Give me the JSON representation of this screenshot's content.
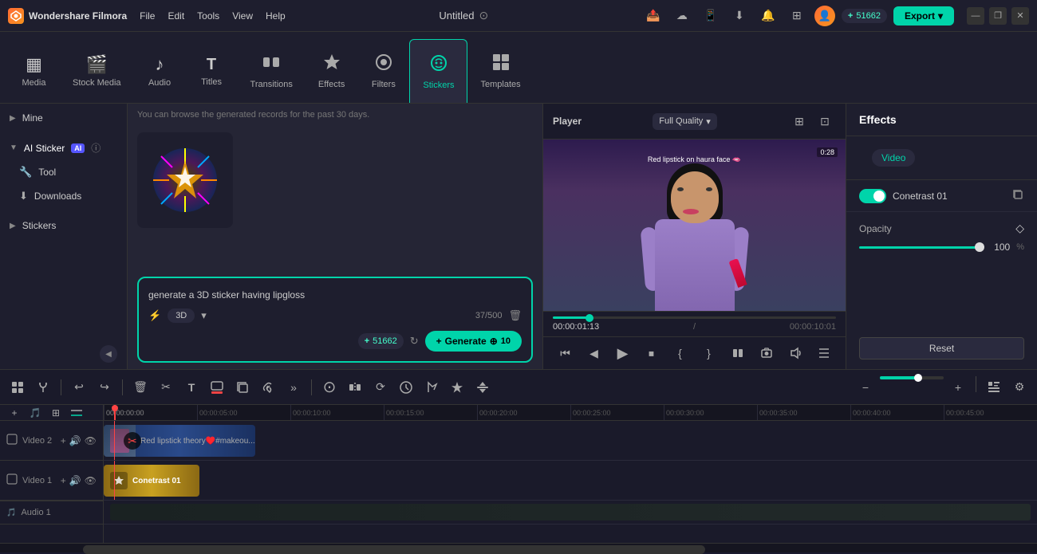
{
  "app": {
    "name": "Wondershare Filmora",
    "logo_text": "W",
    "project_title": "Untitled"
  },
  "menu": {
    "items": [
      "File",
      "Edit",
      "Tools",
      "View",
      "Help"
    ]
  },
  "toolbar": {
    "tabs": [
      {
        "id": "media",
        "label": "Media",
        "icon": "▦"
      },
      {
        "id": "stock",
        "label": "Stock Media",
        "icon": "🎬"
      },
      {
        "id": "audio",
        "label": "Audio",
        "icon": "♪"
      },
      {
        "id": "titles",
        "label": "Titles",
        "icon": "T"
      },
      {
        "id": "transitions",
        "label": "Transitions",
        "icon": "⊡"
      },
      {
        "id": "effects",
        "label": "Effects",
        "icon": "✦"
      },
      {
        "id": "filters",
        "label": "Filters",
        "icon": "◉"
      },
      {
        "id": "stickers",
        "label": "Stickers",
        "icon": "⊛",
        "active": true
      },
      {
        "id": "templates",
        "label": "Templates",
        "icon": "⊞"
      }
    ]
  },
  "sidebar": {
    "items": [
      {
        "label": "Mine",
        "type": "collapsible",
        "expanded": false
      },
      {
        "label": "AI Sticker",
        "type": "collapsible",
        "expanded": true,
        "has_ai": true,
        "has_info": true
      },
      {
        "label": "Tool",
        "type": "sub",
        "icon": "🔧"
      },
      {
        "label": "Downloads",
        "type": "sub",
        "icon": "⬇"
      },
      {
        "label": "Stickers",
        "type": "collapsible",
        "expanded": false
      }
    ]
  },
  "content": {
    "info_text": "You can browse the generated records for the past 30 days.",
    "generate_prompt": "generate a 3D sticker having lipgloss",
    "char_count": "37/500",
    "style_tag": "3D",
    "credits_value": "51662",
    "generate_btn_label": "Generate",
    "generate_credits": "10",
    "refresh_tooltip": "Refresh"
  },
  "player": {
    "label": "Player",
    "quality": "Full Quality",
    "time_current": "00:00:01:13",
    "time_total": "00:00:10:01",
    "progress_percent": 13,
    "video_text": "0:28",
    "video_overlay": "Red lipstick on haura face 🫦",
    "controls": [
      "skip-back",
      "prev-frame",
      "play",
      "stop",
      "mark-in",
      "mark-out",
      "ripple-edit",
      "snapshot",
      "volume",
      "more"
    ]
  },
  "effects_panel": {
    "title": "Effects",
    "video_tab": "Video",
    "effect_name": "Conetrast 01",
    "effect_enabled": true,
    "opacity_label": "Opacity",
    "opacity_value": "100",
    "opacity_percent": "%",
    "reset_label": "Reset"
  },
  "timeline": {
    "tracks": [
      {
        "id": "video2",
        "label": "Video 2",
        "number": "2"
      },
      {
        "id": "video1",
        "label": "Video 1",
        "number": "1"
      },
      {
        "id": "audio1",
        "label": "Audio 1",
        "number": "1"
      }
    ],
    "clips": {
      "video2_label": "Red lipstick theory♥️#makeou...",
      "video1_label": "Conetrast 01"
    },
    "ruler_marks": [
      "00:00:05:00",
      "00:00:10:00",
      "00:00:15:00",
      "00:00:20:00",
      "00:00:25:00",
      "00:00:30:00",
      "00:00:35:00",
      "00:00:40:00",
      "00:00:45:00"
    ]
  },
  "tl_toolbar": {
    "undo_label": "↩",
    "redo_label": "↪",
    "delete_label": "🗑",
    "cut_label": "✂",
    "text_label": "T",
    "zoom_in_label": "+",
    "zoom_out_label": "−"
  },
  "credits": {
    "value": "51662"
  },
  "export_label": "Export",
  "export_chevron": "▾"
}
